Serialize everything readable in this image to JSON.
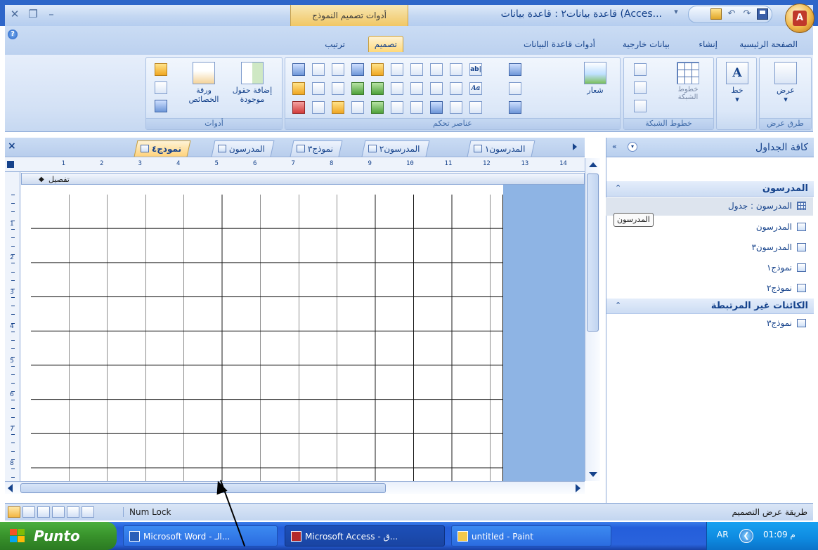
{
  "window": {
    "title": "قاعدة بيانات٢ : قاعدة بيانات (Acces...",
    "context_tab_header": "أدوات تصميم النموذج",
    "office_button_letter": "A"
  },
  "ribbon": {
    "tabs": [
      {
        "label": "الصفحة الرئيسية",
        "active": false
      },
      {
        "label": "إنشاء",
        "active": false
      },
      {
        "label": "بيانات خارجية",
        "active": false
      },
      {
        "label": "أدوات قاعدة البيانات",
        "active": false
      },
      {
        "label": "تصميم",
        "active": true
      },
      {
        "label": "ترتيب",
        "active": false
      }
    ],
    "groups": {
      "views": {
        "label": "طرق عرض",
        "button": "عرض"
      },
      "font": {
        "button": "خط",
        "letter": "A"
      },
      "gridlines": {
        "label": "خطوط الشبكة",
        "button_line1": "خطوط",
        "button_line2": "الشبكة"
      },
      "controls": {
        "label": "عناصر تحكم",
        "logo_button": "شعار",
        "textbox_glyph": "ab|",
        "label_glyph": "Aa"
      },
      "tools": {
        "label": "أدوات",
        "add_fields_line1": "إضافة حقول",
        "add_fields_line2": "موجودة",
        "property_sheet_line1": "ورقة",
        "property_sheet_line2": "الخصائص"
      }
    }
  },
  "documents": {
    "tabs": [
      {
        "label": "المدرسون١",
        "active": false
      },
      {
        "label": "المدرسون٢",
        "active": false
      },
      {
        "label": "نموذج٣",
        "active": false
      },
      {
        "label": "المدرسون",
        "active": false
      },
      {
        "label": "نموذج٤",
        "active": true
      }
    ],
    "close_glyph": "×"
  },
  "designer": {
    "section_label": "تفصيل",
    "section_arrow": "◆",
    "ruler_numbers": [
      "1",
      "2",
      "3",
      "4",
      "5",
      "6",
      "7",
      "8",
      "9",
      "10",
      "11",
      "12",
      "13",
      "14"
    ],
    "vruler_numbers": [
      "1",
      "2",
      "3",
      "4",
      "5",
      "6",
      "7",
      "8"
    ]
  },
  "nav_pane": {
    "title": "كافة الجداول",
    "collapse_glyph": "«",
    "groups": [
      {
        "title": "المدرسون",
        "items": [
          {
            "label": "المدرسون : جدول",
            "type": "table",
            "selected": true
          },
          {
            "label": "المدرسون",
            "type": "form",
            "selected": false
          },
          {
            "label": "المدرسون٣",
            "type": "form",
            "selected": false
          },
          {
            "label": "نموذج١",
            "type": "form",
            "selected": false
          },
          {
            "label": "نموذج٢",
            "type": "form",
            "selected": false
          }
        ]
      },
      {
        "title": "الكائنات غير المرتبطة",
        "items": [
          {
            "label": "نموذج٣",
            "type": "form",
            "selected": false
          }
        ]
      }
    ],
    "tooltip": "المدرسون",
    "group_collapse_glyph": "⌃"
  },
  "statusbar": {
    "view_label": "طريقة عرض التصميم",
    "numlock": "Num Lock"
  },
  "taskbar": {
    "start_label": "Punto",
    "tasks": [
      {
        "label": "Microsoft Word - الـ...",
        "active": false
      },
      {
        "label": "Microsoft Access - ق...",
        "active": true
      },
      {
        "label": "untitled - Paint",
        "active": false
      }
    ],
    "lang": "AR",
    "clock": "01:09 م"
  },
  "colors": {
    "accent": "#15428b",
    "ribbon_bg": "#d3e1f5",
    "canvas_bg": "#8eb4e4",
    "taskbar": "#245edb",
    "start_green": "#38922b",
    "active_tab": "#ffd27a"
  }
}
